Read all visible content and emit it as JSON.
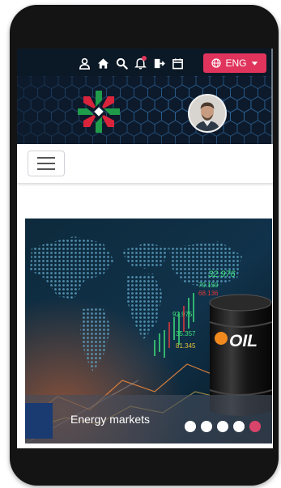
{
  "header": {
    "icons": [
      "user-icon",
      "home-icon",
      "search-icon",
      "bell-icon",
      "sign-out-icon",
      "calendar-icon"
    ],
    "language_label": "ENG",
    "accent_color": "#e0345c"
  },
  "banner": {
    "ticker_values": [
      "32.976",
      "79.150",
      "68.136",
      "92.975",
      "35.357",
      "81.345"
    ],
    "barrel_text": "OIL",
    "caption": "Energy markets",
    "slide_count": 5,
    "active_slide": 5
  }
}
